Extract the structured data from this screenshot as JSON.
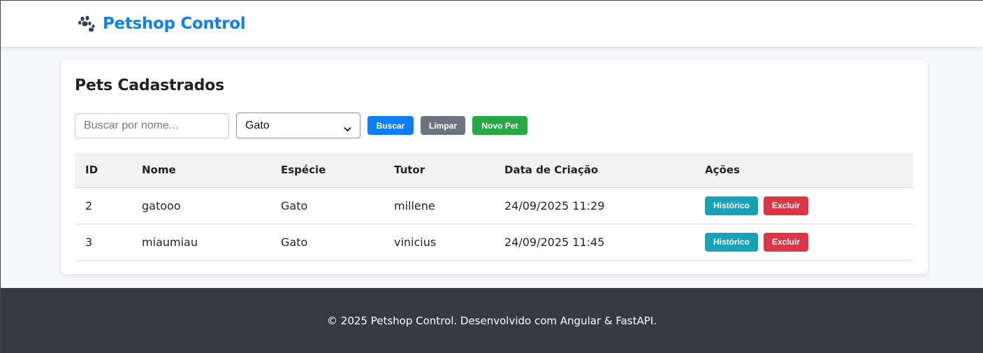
{
  "navbar": {
    "brand_icon": "paw-icon",
    "brand_title": "Petshop Control",
    "brand_color": "#0d7ff2"
  },
  "main": {
    "title": "Pets Cadastrados",
    "search": {
      "placeholder": "Buscar por nome...",
      "value": ""
    },
    "species_select": {
      "selected": "Gato"
    },
    "buttons": {
      "search": "Buscar",
      "clear": "Limpar",
      "new_pet": "Novo Pet"
    },
    "table": {
      "headers": [
        "ID",
        "Nome",
        "Espécie",
        "Tutor",
        "Data de Criação",
        "Ações"
      ],
      "rows": [
        {
          "id": "2",
          "nome": "gatooo",
          "especie": "Gato",
          "tutor": "millene",
          "data": "24/09/2025 11:29",
          "history": "Histórico",
          "delete": "Excluir"
        },
        {
          "id": "3",
          "nome": "miaumiau",
          "especie": "Gato",
          "tutor": "vinicius",
          "data": "24/09/2025 11:45",
          "history": "Histórico",
          "delete": "Excluir"
        }
      ]
    }
  },
  "footer": {
    "text": "© 2025 Petshop Control. Desenvolvido com Angular & FastAPI."
  },
  "colors": {
    "primary": "#0d7ff2",
    "secondary": "#6c757d",
    "success": "#28a745",
    "info": "#17a2b8",
    "danger": "#dc3545",
    "footer_bg": "#343a40"
  }
}
